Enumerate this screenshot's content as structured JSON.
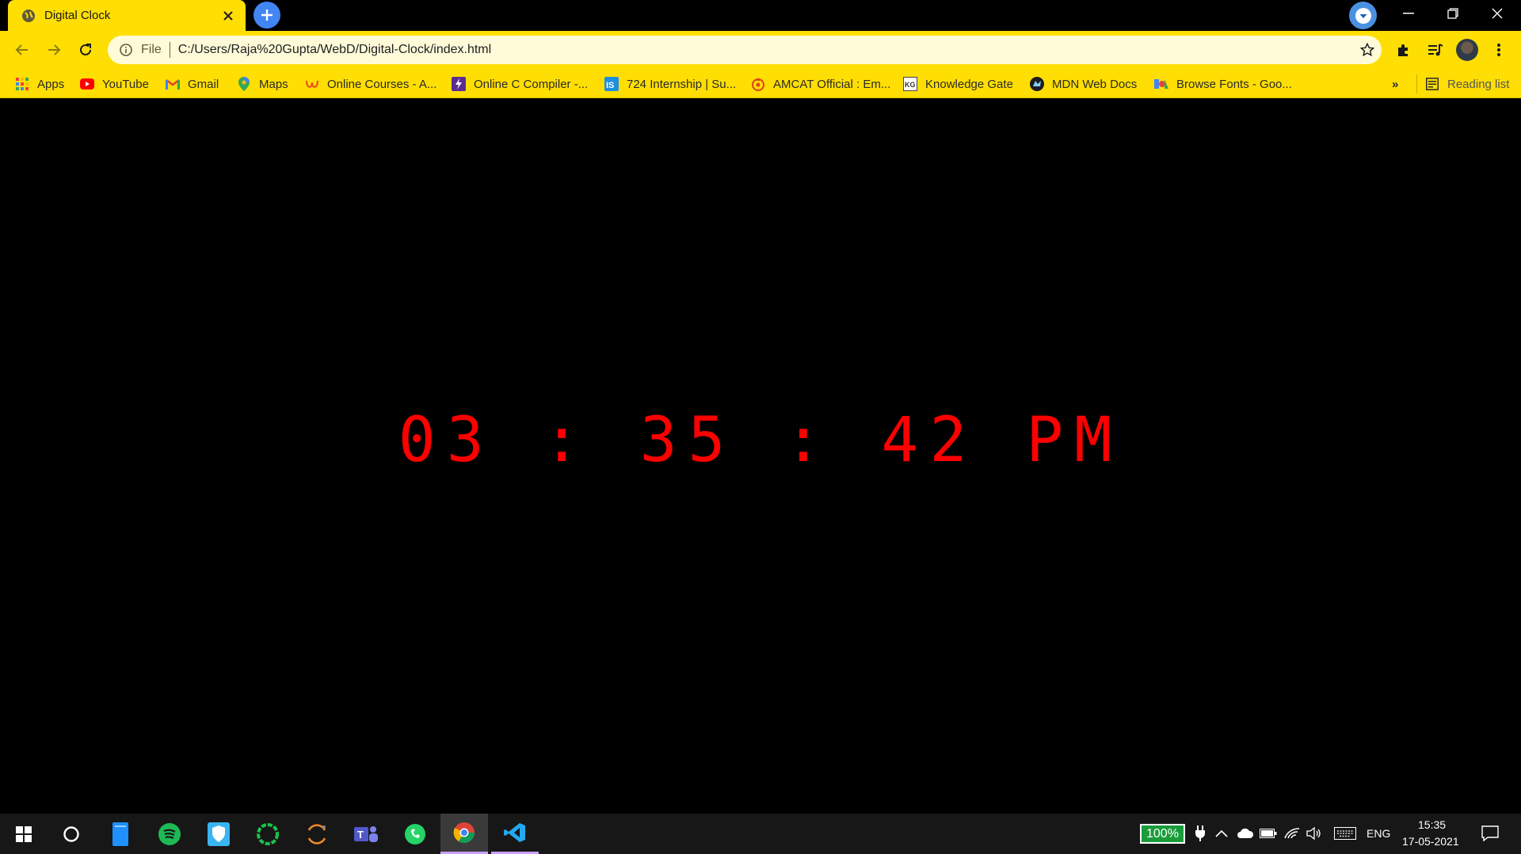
{
  "tab": {
    "title": "Digital Clock"
  },
  "omnibox": {
    "scheme_label": "File",
    "url": "C:/Users/Raja%20Gupta/WebD/Digital-Clock/index.html"
  },
  "bookmarks": [
    {
      "label": "Apps",
      "icon": "apps-grid-icon"
    },
    {
      "label": "YouTube",
      "icon": "youtube-icon"
    },
    {
      "label": "Gmail",
      "icon": "gmail-icon"
    },
    {
      "label": "Maps",
      "icon": "maps-icon"
    },
    {
      "label": "Online Courses - A...",
      "icon": "udemy-icon"
    },
    {
      "label": "Online C Compiler -...",
      "icon": "compiler-icon"
    },
    {
      "label": "724 Internship | Su...",
      "icon": "internshala-icon"
    },
    {
      "label": "AMCAT Official : Em...",
      "icon": "amcat-icon"
    },
    {
      "label": "Knowledge Gate",
      "icon": "knowledge-gate-icon"
    },
    {
      "label": "MDN Web Docs",
      "icon": "mdn-icon"
    },
    {
      "label": "Browse Fonts - Goo...",
      "icon": "google-fonts-icon"
    }
  ],
  "bookmarks_more": "»",
  "reading_list": {
    "label": "Reading list"
  },
  "clock": {
    "display": "03 : 35 : 42 PM",
    "color": "#ff0000"
  },
  "taskbar": {
    "battery": "100%",
    "language": "ENG",
    "time": "15:35",
    "date": "17-05-2021"
  },
  "theme": {
    "accent": "#ffde03",
    "omnibox": "#fffbd9",
    "background": "#000000"
  }
}
